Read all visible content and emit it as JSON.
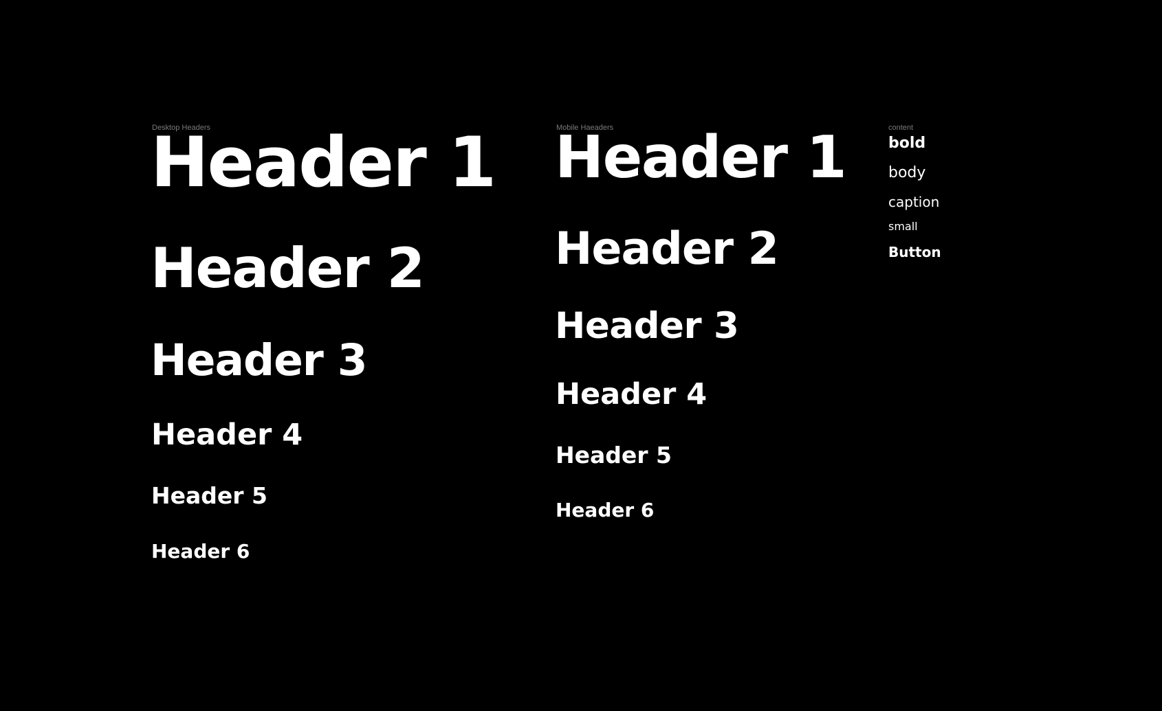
{
  "desktop": {
    "label": "Desktop Headers",
    "headers": [
      "Header 1",
      "Header 2",
      "Header 3",
      "Header 4",
      "Header 5",
      "Header 6"
    ]
  },
  "mobile": {
    "label": "Mobile Haeaders",
    "headers": [
      "Header 1",
      "Header 2",
      "Header 3",
      "Header 4",
      "Header 5",
      "Header 6"
    ]
  },
  "content": {
    "label": "content",
    "items": [
      "bold",
      "body",
      "caption",
      "small",
      "Button"
    ]
  },
  "colors": {
    "background": "#000000",
    "text": "#ffffff",
    "label": "#7a7a7a"
  }
}
